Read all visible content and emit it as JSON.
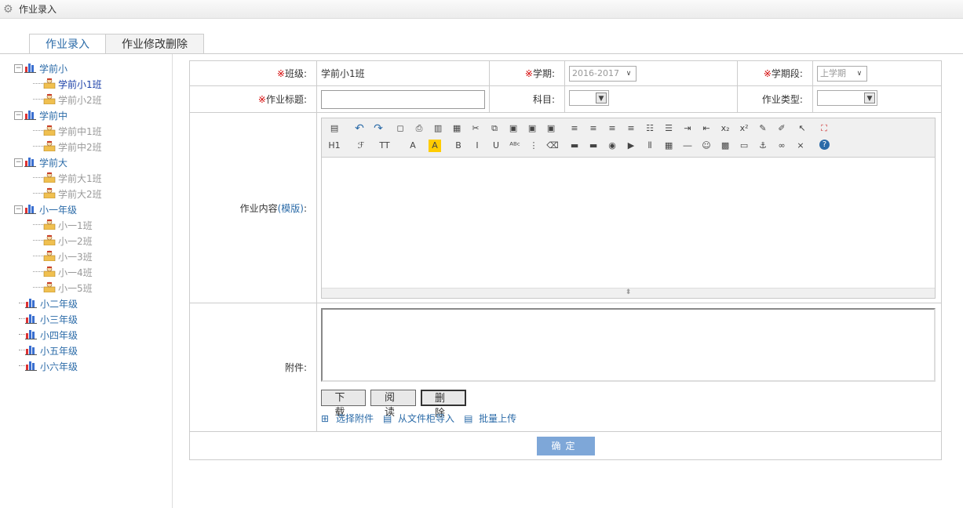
{
  "window": {
    "title": "作业录入"
  },
  "tabs": [
    {
      "label": "作业录入"
    },
    {
      "label": "作业修改删除"
    }
  ],
  "tree": {
    "groups": [
      {
        "label": "学前小",
        "children": [
          "学前小1班",
          "学前小2班"
        ]
      },
      {
        "label": "学前中",
        "children": [
          "学前中1班",
          "学前中2班"
        ]
      },
      {
        "label": "学前大",
        "children": [
          "学前大1班",
          "学前大2班"
        ]
      },
      {
        "label": "小一年级",
        "children": [
          "小一1班",
          "小一2班",
          "小一3班",
          "小一4班",
          "小一5班"
        ]
      },
      {
        "label": "小二年级"
      },
      {
        "label": "小三年级"
      },
      {
        "label": "小四年级"
      },
      {
        "label": "小五年级"
      },
      {
        "label": "小六年级"
      }
    ],
    "selected": "学前小1班"
  },
  "form": {
    "required_mark": "※",
    "class_label": "班级:",
    "class_value": "学前小1班",
    "term_label": "学期:",
    "term_value": "2016-2017",
    "term_part_label": "学期段:",
    "term_part_value": "上学期",
    "title_label": "作业标题:",
    "title_value": "",
    "subject_label": "科目:",
    "subject_value": "",
    "type_label": "作业类型:",
    "type_value": "",
    "content_label": "作业内容",
    "template_link": "(模版)",
    "content_colon": ":",
    "attach_label": "附件:",
    "download_button": "下载",
    "read_button": "阅读",
    "delete_button": "删除",
    "select_attach": "选择附件",
    "from_cabinet": "从文件柜导入",
    "batch_upload": "批量上传",
    "submit_button": "确定"
  },
  "colors": {
    "link": "#2b6ba8",
    "required": "#d40000",
    "submit_bg": "#7ea7d8"
  }
}
